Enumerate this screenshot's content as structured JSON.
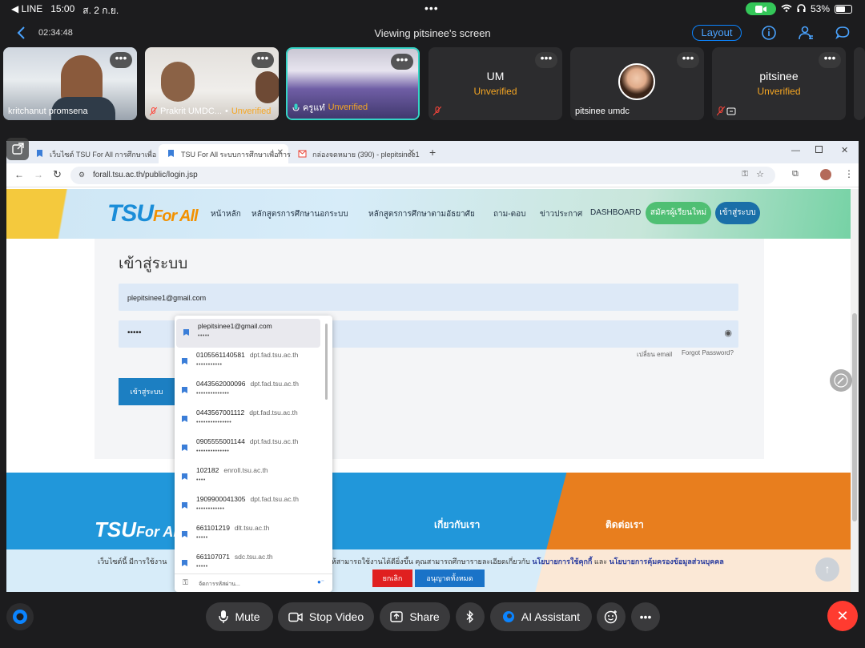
{
  "status_bar": {
    "app": "◀ LINE",
    "time": "15:00",
    "date": "ส. 2 ก.ย.",
    "dots": "•••",
    "battery": "53%"
  },
  "top_bar": {
    "timer": "02:34:48",
    "title": "Viewing pitsinee's screen",
    "layout_label": "Layout"
  },
  "tiles": [
    {
      "name": "kritchanut promsena"
    },
    {
      "name": "Prakrit UMDC...",
      "status": "Unverified"
    },
    {
      "name": "ครูแท๋",
      "status": "Unverified"
    },
    {
      "name": "UM",
      "status": "Unverified"
    },
    {
      "name": "pitsinee  umdc"
    },
    {
      "name": "pitsinee",
      "status": "Unverified"
    }
  ],
  "more_label": "•••",
  "browser": {
    "tabs": [
      {
        "label": "เว็บไซต์ TSU For All การศึกษาเพื่อ"
      },
      {
        "label": "TSU For All ระบบการศึกษาเพื่อการ"
      },
      {
        "label": "กล่องจดหมาย (390) - plepitsinee1"
      }
    ],
    "new_tab": "+",
    "url": "forall.tsu.ac.th/public/login.jsp"
  },
  "site": {
    "logo_main": "TSU",
    "logo_sub": "For All",
    "nav": [
      "หน้าหลัก",
      "หลักสูตรการศึกษานอกระบบ",
      "หลักสูตรการศึกษาตามอัธยาศัย",
      "ถาม-ตอบ",
      "ข่าวประกาศ",
      "DASHBOARD"
    ],
    "register_label": "สมัครผู้เรียนใหม่",
    "login_nav_label": "เข้าสู่ระบบ"
  },
  "login": {
    "title": "เข้าสู่ระบบ",
    "email_value": "plepitsinee1@gmail.com",
    "password_value": "•••••",
    "change_email": "เปลี่ยน email",
    "forgot_password": "Forgot Password?",
    "submit_label": "เข้าสู่ระบบ"
  },
  "autofill": {
    "items": [
      {
        "user": "plepitsinee1@gmail.com",
        "domain": "",
        "pass": "•••••"
      },
      {
        "user": "0105561140581",
        "domain": "dpt.fad.tsu.ac.th",
        "pass": "•••••••••••"
      },
      {
        "user": "0443562000096",
        "domain": "dpt.fad.tsu.ac.th",
        "pass": "••••••••••••••"
      },
      {
        "user": "0443567001112",
        "domain": "dpt.fad.tsu.ac.th",
        "pass": "•••••••••••••••"
      },
      {
        "user": "0905555001144",
        "domain": "dpt.fad.tsu.ac.th",
        "pass": "••••••••••••••"
      },
      {
        "user": "102182",
        "domain": "enroll.tsu.ac.th",
        "pass": "••••"
      },
      {
        "user": "1909900041305",
        "domain": "dpt.fad.tsu.ac.th",
        "pass": "••••••••••••"
      },
      {
        "user": "661101219",
        "domain": "dlt.tsu.ac.th",
        "pass": "•••••"
      },
      {
        "user": "661107071",
        "domain": "sdc.tsu.ac.th",
        "pass": "•••••"
      }
    ],
    "manage_label": "จัดการรหัสผ่าน..."
  },
  "footer": {
    "about": "เกี่ยวกับเรา",
    "contact": "ติดต่อเรา",
    "cookie_text_start": "เว็บไซต์นี้ มีการใช้งาน",
    "cookie_text_mid": "ให้สามารถใช้งานได้ดียิ่งขึ้น คุณสามารถศึกษารายละเอียดเกี่ยวกับ",
    "cookie_link1": "นโยบายการใช้คุกกี้",
    "cookie_and": "และ",
    "cookie_link2": "นโยบายการคุ้มครองข้อมูลส่วนบุคคล",
    "cancel_label": "ยกเลิก",
    "accept_label": "อนุญาตทั้งหมด"
  },
  "bottom_bar": {
    "mute": "Mute",
    "stop_video": "Stop Video",
    "share": "Share",
    "ai_assistant": "AI Assistant",
    "end": "✕"
  },
  "colors": {
    "accent": "#0b84ff",
    "unverified": "#f5a623",
    "end_red": "#ff3b30",
    "site_blue": "#2197da",
    "site_orange": "#e87e1e"
  }
}
